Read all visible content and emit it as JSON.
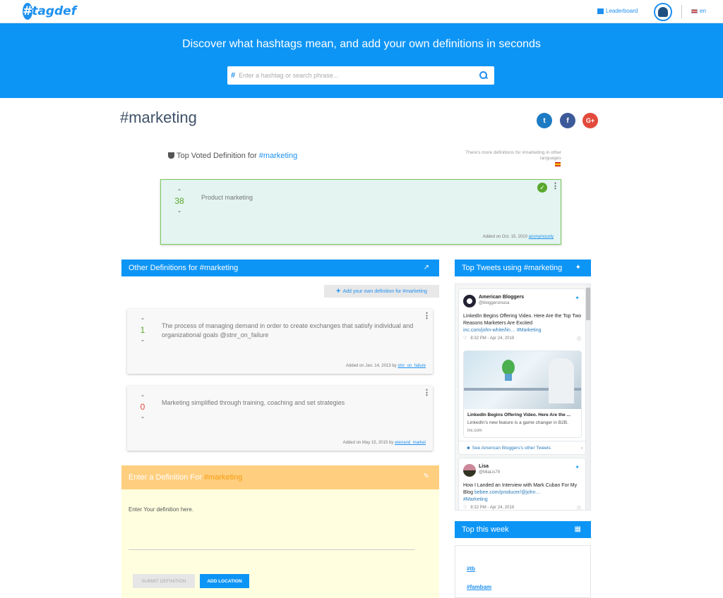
{
  "nav": {
    "logo_text": "tagdef",
    "leaderboard": "Leaderboard",
    "language": "en"
  },
  "hero": {
    "title": "Discover what hashtags mean, and add your own definitions in seconds",
    "search_placeholder": "Enter a hashtag or search phrase..."
  },
  "page": {
    "title": "#marketing",
    "share": {
      "twitter": "t",
      "facebook": "f",
      "google": "G+"
    }
  },
  "top_voted": {
    "heading": "Top Voted Definition for ",
    "tag": "#marketing",
    "other_languages": "There's more definitions for #marketing in other languages",
    "votes": "38",
    "text": "Product marketing",
    "added": "Added on Oct. 15, 2010",
    "user": "anonymously"
  },
  "other_defs": {
    "heading": "Other Definitions for #marketing",
    "add_own": "Add your own definition for #marketing",
    "items": [
      {
        "votes": "1",
        "text": "The process of managing demand in order to create exchanges that satisfy individual and organizational goals @stnr_on_failure",
        "added": "Added on Jan. 14, 2013 by",
        "user": "stnr_on_failure"
      },
      {
        "votes": "0",
        "text": "Marketing simplified through training, coaching and set strategies",
        "added": "Added on May 15, 2015 by",
        "user": "wienand_market"
      }
    ]
  },
  "enter": {
    "heading": "Enter a Definition For",
    "tag": "#marketing",
    "placeholder": "Enter Your definition here.",
    "submit": "SUBMIT DEFINITION",
    "add_location": "ADD LOCATION"
  },
  "tweets": {
    "heading": "Top Tweets using #marketing",
    "items": [
      {
        "name": "American Bloggers",
        "handle": "@bloggersinusa",
        "text_1": "LinkedIn Begins Offering Video. Here Are the Top Two Reasons Marketers Are Excited",
        "link": "inc.com/john-white/lin… #Marketing",
        "time": "8:32 PM - Apr 24, 2019",
        "card_title": "LinkedIn Begins Offering Video. Here Are the ...",
        "card_desc": "LinkedIn's new feature is a game changer in B2B.",
        "card_domain": "inc.com",
        "see_more": "See American Bloggers's other Tweets"
      },
      {
        "name": "Lisa",
        "handle": "@MiaLis79",
        "text_1": "How I Landed an Interview with Mark Cuban For My Blog",
        "link": "bebee.com/producer/@john…",
        "hashtag": "#Marketing",
        "time": "8:32 PM - Apr 24, 2019"
      }
    ]
  },
  "week": {
    "heading": "Top this week",
    "items": [
      "#tb",
      "#fambam"
    ]
  },
  "colors": {
    "primary": "#0d95f6",
    "vote_positive": "#5aa82d",
    "vote_zero": "#e24a3b",
    "enter_header": "#ffcf7f",
    "enter_body": "#ffffe0"
  }
}
